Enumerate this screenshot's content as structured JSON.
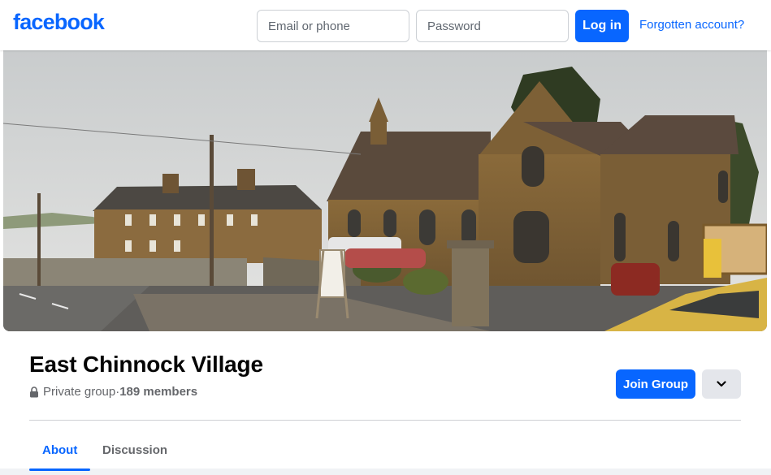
{
  "header": {
    "logo": "facebook",
    "email_placeholder": "Email or phone",
    "password_placeholder": "Password",
    "login_label": "Log in",
    "forgot_label": "Forgotten account?"
  },
  "group": {
    "name": "East Chinnock Village",
    "privacy": "Private group",
    "separator": " · ",
    "members": "189 members",
    "join_label": "Join Group"
  },
  "tabs": [
    {
      "label": "About",
      "active": true
    },
    {
      "label": "Discussion",
      "active": false
    }
  ],
  "colors": {
    "brand": "#0866ff",
    "secondary_button": "#e4e6eb",
    "text_secondary": "#65676b"
  },
  "icons": [
    "lock-icon",
    "chevron-down-icon"
  ]
}
